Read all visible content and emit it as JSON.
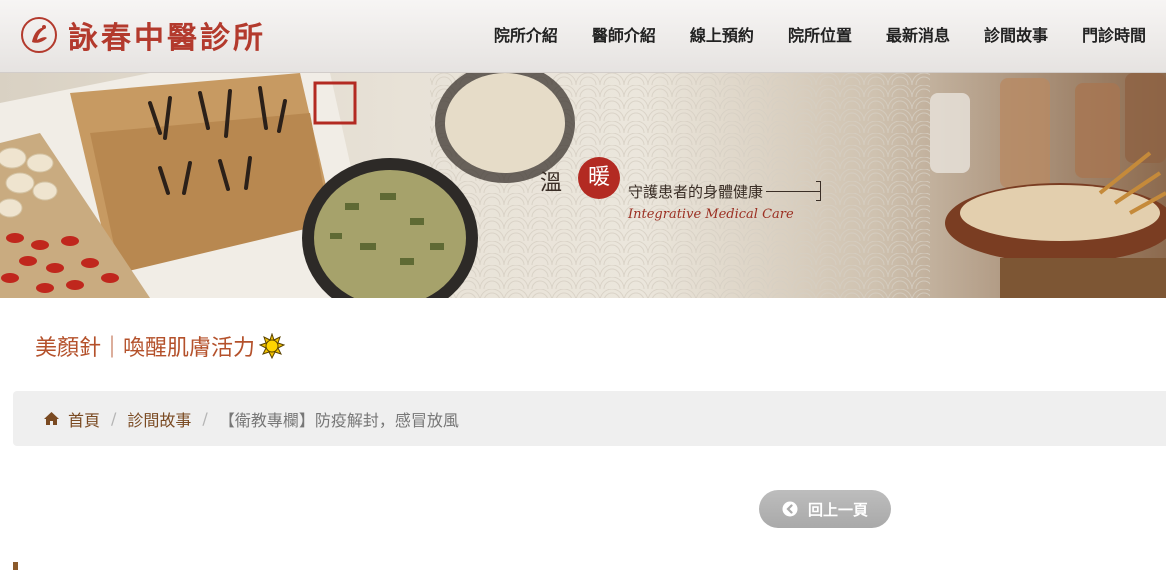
{
  "header": {
    "logo_text": "詠春中醫診所",
    "nav": [
      "院所介紹",
      "醫師介紹",
      "線上預約",
      "院所位置",
      "最新消息",
      "診間故事",
      "門診時間"
    ]
  },
  "banner": {
    "slogan_main": "溫",
    "slogan_seal": "暖",
    "slogan_sub": "守護患者的身體健康",
    "slogan_en": "Integrative Medical Care"
  },
  "page": {
    "title": "美顏針｜喚醒肌膚活力",
    "title_icon": "sun-emoji-icon"
  },
  "breadcrumb": {
    "home": "首頁",
    "section": "診間故事",
    "current": "【衛教專欄】防疫解封，感冒放風"
  },
  "back_button": {
    "label": "回上一頁"
  },
  "colors": {
    "brand_red": "#b33a2d",
    "title_orange": "#b4512b",
    "breadcrumb_link": "#7a4a22",
    "button_gray": "#b3b3b3"
  }
}
